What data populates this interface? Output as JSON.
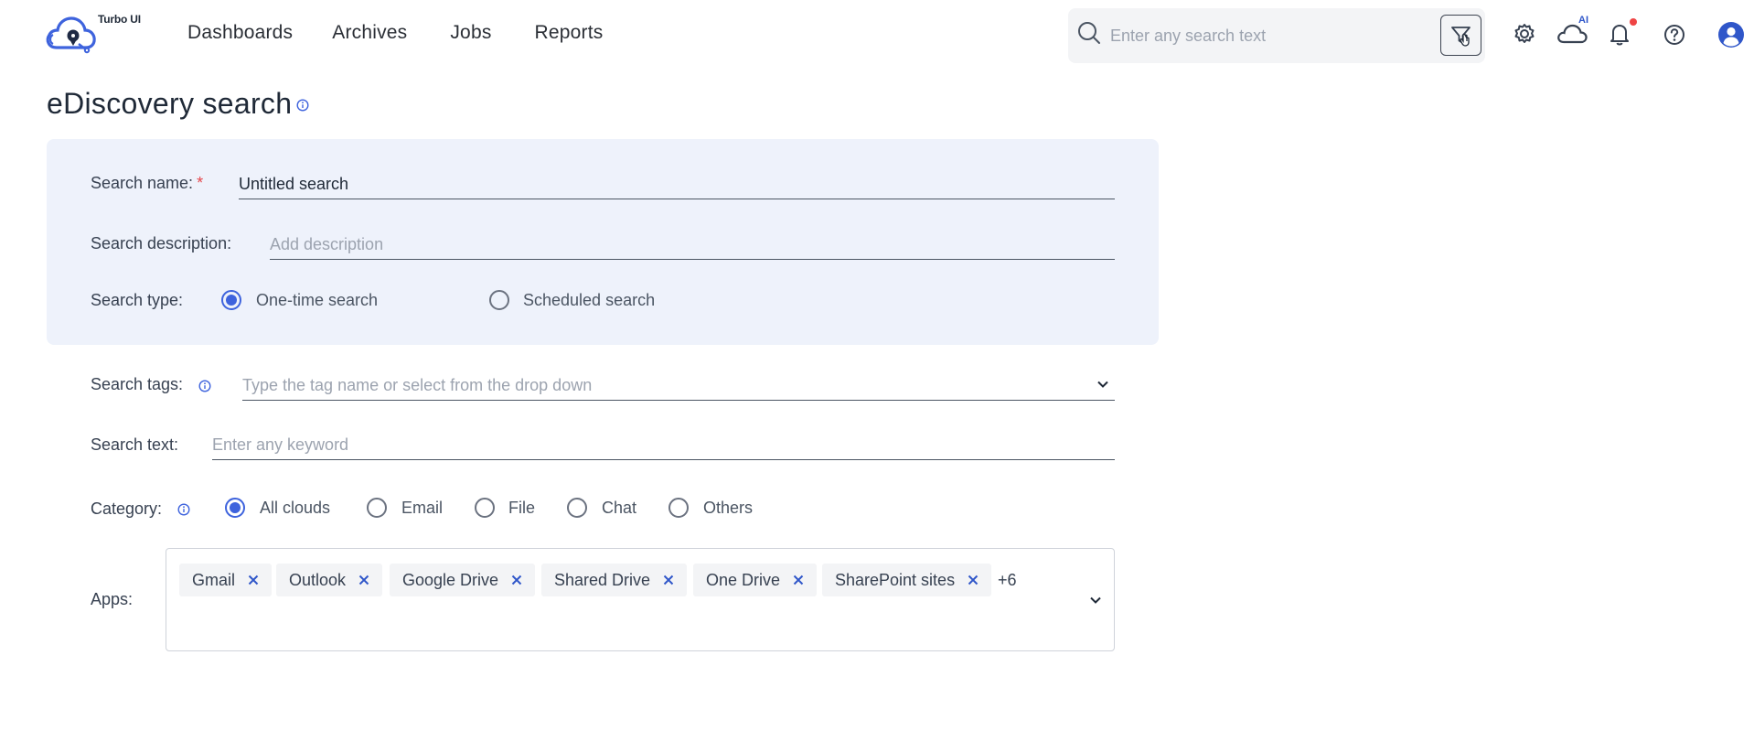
{
  "app": {
    "logo_text": "Turbo UI"
  },
  "nav": [
    "Dashboards",
    "Archives",
    "Jobs",
    "Reports"
  ],
  "header": {
    "search_placeholder": "Enter any search text",
    "ai_badge": "AI"
  },
  "page": {
    "title": "eDiscovery search"
  },
  "form": {
    "search_name": {
      "label": "Search name:",
      "required_mark": "*",
      "value": "Untitled search"
    },
    "search_description": {
      "label": "Search description:",
      "placeholder": "Add description"
    },
    "search_type": {
      "label": "Search type:",
      "options": [
        "One-time search",
        "Scheduled search"
      ],
      "selected": "One-time search"
    },
    "search_tags": {
      "label": "Search tags:",
      "placeholder": "Type the tag name or select from the drop down"
    },
    "search_text": {
      "label": "Search text:",
      "placeholder": "Enter any keyword"
    },
    "category": {
      "label": "Category:",
      "options": [
        "All clouds",
        "Email",
        "File",
        "Chat",
        "Others"
      ],
      "selected": "All clouds"
    },
    "apps": {
      "label": "Apps:",
      "chips": [
        "Gmail",
        "Outlook",
        "Google Drive",
        "Shared Drive",
        "One Drive",
        "SharePoint sites"
      ],
      "more": "+6"
    }
  },
  "colors": {
    "accent": "#3e63dd",
    "panel_bg": "#eef2fb",
    "required": "#e5484d",
    "notification": "#ef4444"
  }
}
